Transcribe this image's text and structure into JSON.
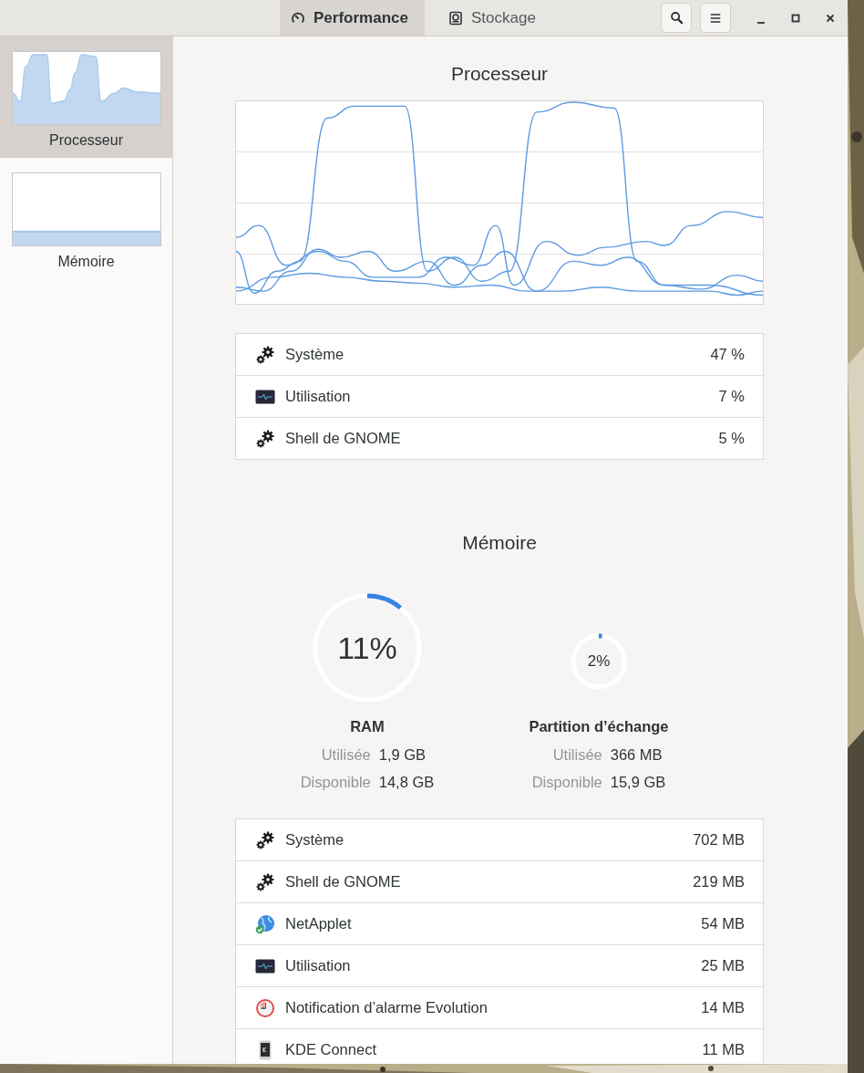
{
  "window": {
    "tabs": [
      {
        "label": "Performance",
        "kind": "gauge",
        "selected": true
      },
      {
        "label": "Stockage",
        "kind": "disk",
        "selected": false
      }
    ]
  },
  "sidebar": {
    "items": [
      {
        "label": "Processeur",
        "kind": "cpu",
        "selected": true
      },
      {
        "label": "Mémoire",
        "kind": "memory",
        "selected": false
      }
    ]
  },
  "processor": {
    "title": "Processeur",
    "processes": [
      {
        "kind": "gears",
        "name": "Système",
        "value": "47 %"
      },
      {
        "kind": "monitor",
        "name": "Utilisation",
        "value": "7 %"
      },
      {
        "kind": "gears",
        "name": "Shell de GNOME",
        "value": "5 %"
      }
    ]
  },
  "memory": {
    "title": "Mémoire",
    "gauges": [
      {
        "kind": "large",
        "percent": "11%",
        "level": 0.11,
        "name": "RAM",
        "rows": [
          {
            "label": "Utilisée",
            "value": "1,9 GB"
          },
          {
            "label": "Disponible",
            "value": "14,8 GB"
          }
        ]
      },
      {
        "kind": "small",
        "percent": "2%",
        "level": 0.02,
        "name": "Partition d’échange",
        "rows": [
          {
            "label": "Utilisée",
            "value": "366 MB"
          },
          {
            "label": "Disponible",
            "value": "15,9 GB"
          }
        ]
      }
    ],
    "processes": [
      {
        "kind": "gears",
        "name": "Système",
        "value": "702 MB"
      },
      {
        "kind": "gears",
        "name": "Shell de GNOME",
        "value": "219 MB"
      },
      {
        "kind": "globe",
        "name": "NetApplet",
        "value": "54 MB"
      },
      {
        "kind": "monitor",
        "name": "Utilisation",
        "value": "25 MB"
      },
      {
        "kind": "clock",
        "name": "Notification d’alarme Evolution",
        "value": "14 MB"
      },
      {
        "kind": "phone",
        "name": "KDE Connect",
        "value": "11 MB"
      }
    ]
  }
}
